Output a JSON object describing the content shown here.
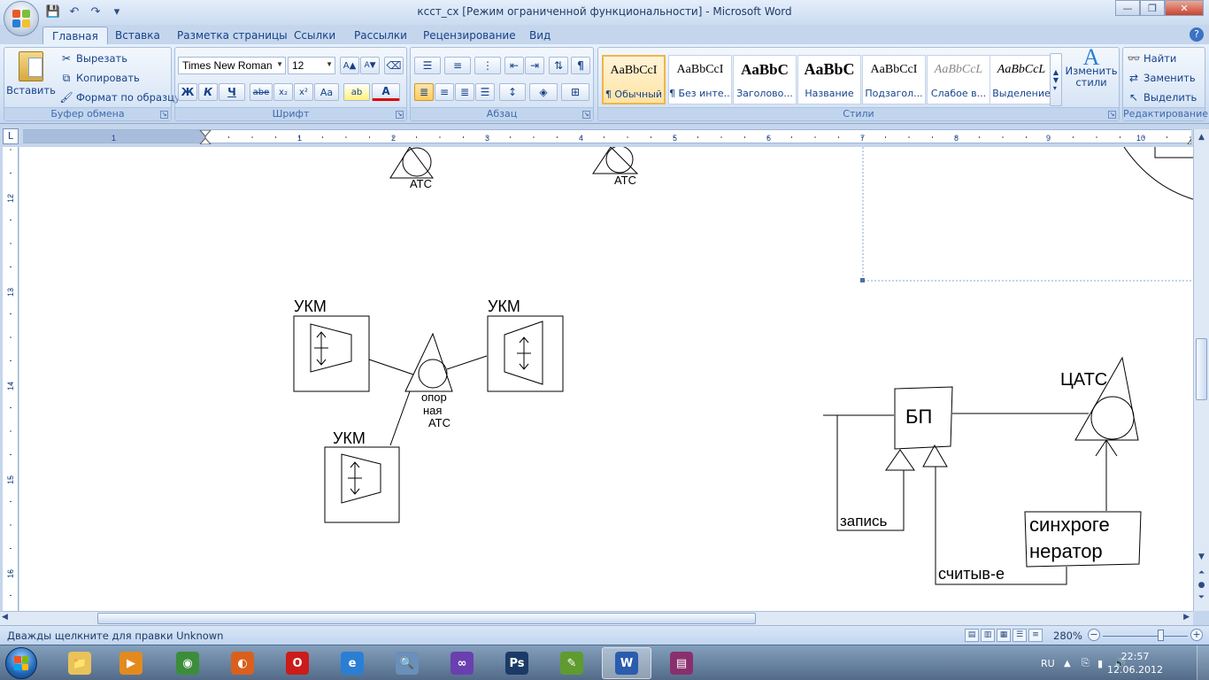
{
  "window": {
    "title": "ксст_сх [Режим ограниченной функциональности] - Microsoft Word",
    "controls": {
      "minimize": "—",
      "restore": "❐",
      "close": "✕"
    }
  },
  "qat": {
    "save": "💾",
    "undo": "↶",
    "redo": "↷",
    "more": "▾"
  },
  "tabs": [
    {
      "label": "Главная",
      "active": true
    },
    {
      "label": "Вставка"
    },
    {
      "label": "Разметка страницы"
    },
    {
      "label": "Ссылки"
    },
    {
      "label": "Рассылки"
    },
    {
      "label": "Рецензирование"
    },
    {
      "label": "Вид"
    }
  ],
  "ribbon": {
    "clipboard": {
      "label": "Буфер обмена",
      "paste": "Вставить",
      "cut": "Вырезать",
      "copy": "Копировать",
      "format_painter": "Формат по образцу"
    },
    "font": {
      "label": "Шрифт",
      "font_name": "Times New Roman",
      "font_size": "12",
      "grow": "A▲",
      "shrink": "A▼",
      "clear": "⌫",
      "bold": "Ж",
      "italic": "К",
      "underline": "Ч",
      "strike": "abe",
      "sub": "x₂",
      "sup": "x²",
      "case": "Aa",
      "highlight": "ab",
      "color": "A"
    },
    "paragraph": {
      "label": "Абзац",
      "pilcrow": "¶"
    },
    "styles": {
      "label": "Стили",
      "items": [
        {
          "sample": "AaBbCcI",
          "name": "¶ Обычный",
          "selected": true
        },
        {
          "sample": "AaBbCcI",
          "name": "¶ Без инте..."
        },
        {
          "sample": "AaBbC",
          "name": "Заголово..."
        },
        {
          "sample": "AaBbC",
          "name": "Название"
        },
        {
          "sample": "AaBbCcI",
          "name": "Подзагол..."
        },
        {
          "sample": "AaBbCcL",
          "name": "Слабое в..."
        },
        {
          "sample": "AaBbCcL",
          "name": "Выделение"
        }
      ],
      "change_styles": "Изменить стили"
    },
    "editing": {
      "label": "Редактирование",
      "find": "Найти",
      "replace": "Заменить",
      "select": "Выделить"
    }
  },
  "ruler": {
    "tab_selector": "L",
    "h_numbers": [
      "1",
      "1",
      "2",
      "3",
      "4",
      "5",
      "6",
      "7",
      "8",
      "9",
      "10"
    ],
    "v_numbers": [
      "12",
      "13",
      "14",
      "15",
      "16"
    ]
  },
  "document": {
    "labels": {
      "ats_top_left": "АТС",
      "ats_top_right": "АТС",
      "ukm_left": "УКМ",
      "ukm_right": "УКМ",
      "ukm_bottom": "УКМ",
      "opornaya_1": "опор",
      "opornaya_2": "ная",
      "opornaya_3": "АТС",
      "bp": "БП",
      "tsats": "ЦАТС",
      "zapis": "запись",
      "sync_1": "синхроге",
      "sync_2": "нератор",
      "schit": "считыв-е"
    }
  },
  "statusbar": {
    "message": "Дважды щелкните для правки Unknown",
    "zoom": "280%",
    "zoom_level_percent": 280
  },
  "taskbar": {
    "lang": "RU",
    "time": "22:57",
    "date": "12.06.2012",
    "apps": [
      {
        "name": "explorer",
        "glyph": "📁",
        "color": "#e9c25a"
      },
      {
        "name": "media-player",
        "glyph": "▶",
        "color": "#e38a1f"
      },
      {
        "name": "chrome",
        "glyph": "◉",
        "color": "#3b8d3b"
      },
      {
        "name": "firefox",
        "glyph": "◐",
        "color": "#d9601c"
      },
      {
        "name": "opera",
        "glyph": "O",
        "color": "#cc1b1b"
      },
      {
        "name": "internet-explorer",
        "glyph": "e",
        "color": "#2a7fd4"
      },
      {
        "name": "search-tool",
        "glyph": "🔍",
        "color": "#6a8fb8"
      },
      {
        "name": "visual-studio",
        "glyph": "∞",
        "color": "#6a3fb0"
      },
      {
        "name": "photoshop",
        "glyph": "Ps",
        "color": "#1b3b66"
      },
      {
        "name": "notepad-plus",
        "glyph": "✎",
        "color": "#5f9b2f"
      },
      {
        "name": "word",
        "glyph": "W",
        "color": "#2b5cae",
        "active": true
      },
      {
        "name": "winrar",
        "glyph": "▤",
        "color": "#8a2f6e"
      }
    ]
  }
}
